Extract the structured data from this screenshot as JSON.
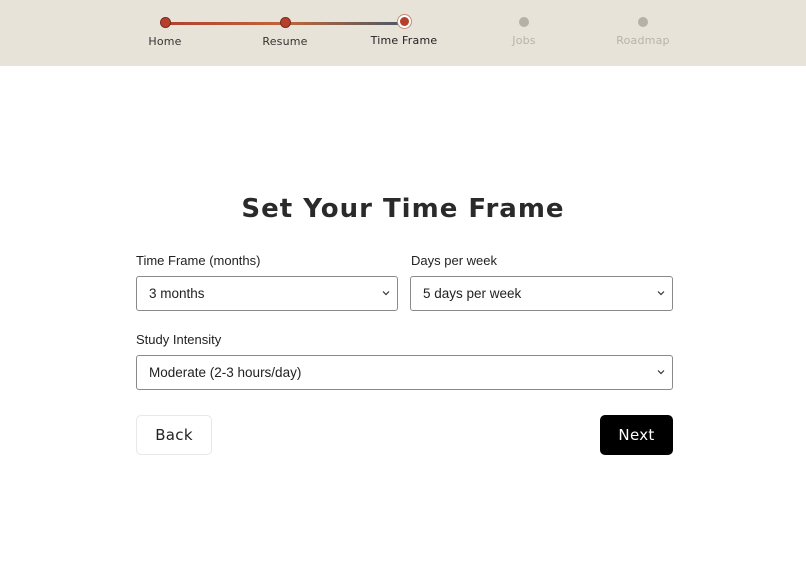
{
  "stepper": {
    "steps": [
      {
        "label": "Home",
        "state": "done"
      },
      {
        "label": "Resume",
        "state": "done"
      },
      {
        "label": "Time Frame",
        "state": "active"
      },
      {
        "label": "Jobs",
        "state": "future"
      },
      {
        "label": "Roadmap",
        "state": "future"
      }
    ]
  },
  "page": {
    "title": "Set Your Time Frame"
  },
  "form": {
    "time_frame": {
      "label": "Time Frame (months)",
      "value": "3 months"
    },
    "days_per_week": {
      "label": "Days per week",
      "value": "5 days per week"
    },
    "study_intensity": {
      "label": "Study Intensity",
      "value": "Moderate (2-3 hours/day)"
    }
  },
  "actions": {
    "back_label": "Back",
    "next_label": "Next"
  },
  "colors": {
    "accent": "#b5412c",
    "stepper_bg": "#e8e3d8",
    "primary_button": "#000000"
  }
}
